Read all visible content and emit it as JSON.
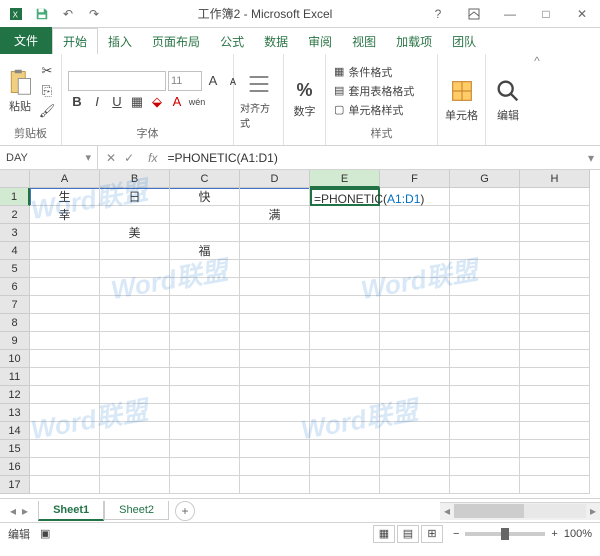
{
  "title": "工作簿2 - Microsoft Excel",
  "tabs": {
    "file": "文件",
    "home": "开始",
    "insert": "插入",
    "layout": "页面布局",
    "formulas": "公式",
    "data": "数据",
    "review": "审阅",
    "view": "视图",
    "addins": "加载项",
    "team": "团队"
  },
  "ribbon": {
    "paste": "粘贴",
    "clipboard": "剪贴板",
    "font": "字体",
    "font_size": "11",
    "align": "对齐方式",
    "number": "数字",
    "cond_fmt": "条件格式",
    "tbl_fmt": "套用表格格式",
    "cell_style": "单元格样式",
    "styles": "样式",
    "cells": "单元格",
    "editing": "编辑"
  },
  "namebox": "DAY",
  "formula": "=PHONETIC(A1:D1)",
  "cell_formula_prefix": "=PHONETIC(",
  "cell_formula_ref": "A1:D1",
  "cell_formula_suffix": ")",
  "columns": [
    "A",
    "B",
    "C",
    "D",
    "E",
    "F",
    "G",
    "H"
  ],
  "rows_count": 17,
  "cells": {
    "A1": "生",
    "B1": "日",
    "C1": "快",
    "A2": "幸",
    "D2": "满",
    "B3": "美",
    "C4": "福"
  },
  "sheets": {
    "s1": "Sheet1",
    "s2": "Sheet2"
  },
  "status": {
    "mode": "编辑",
    "zoom": "100%"
  },
  "watermark": "Word联盟"
}
